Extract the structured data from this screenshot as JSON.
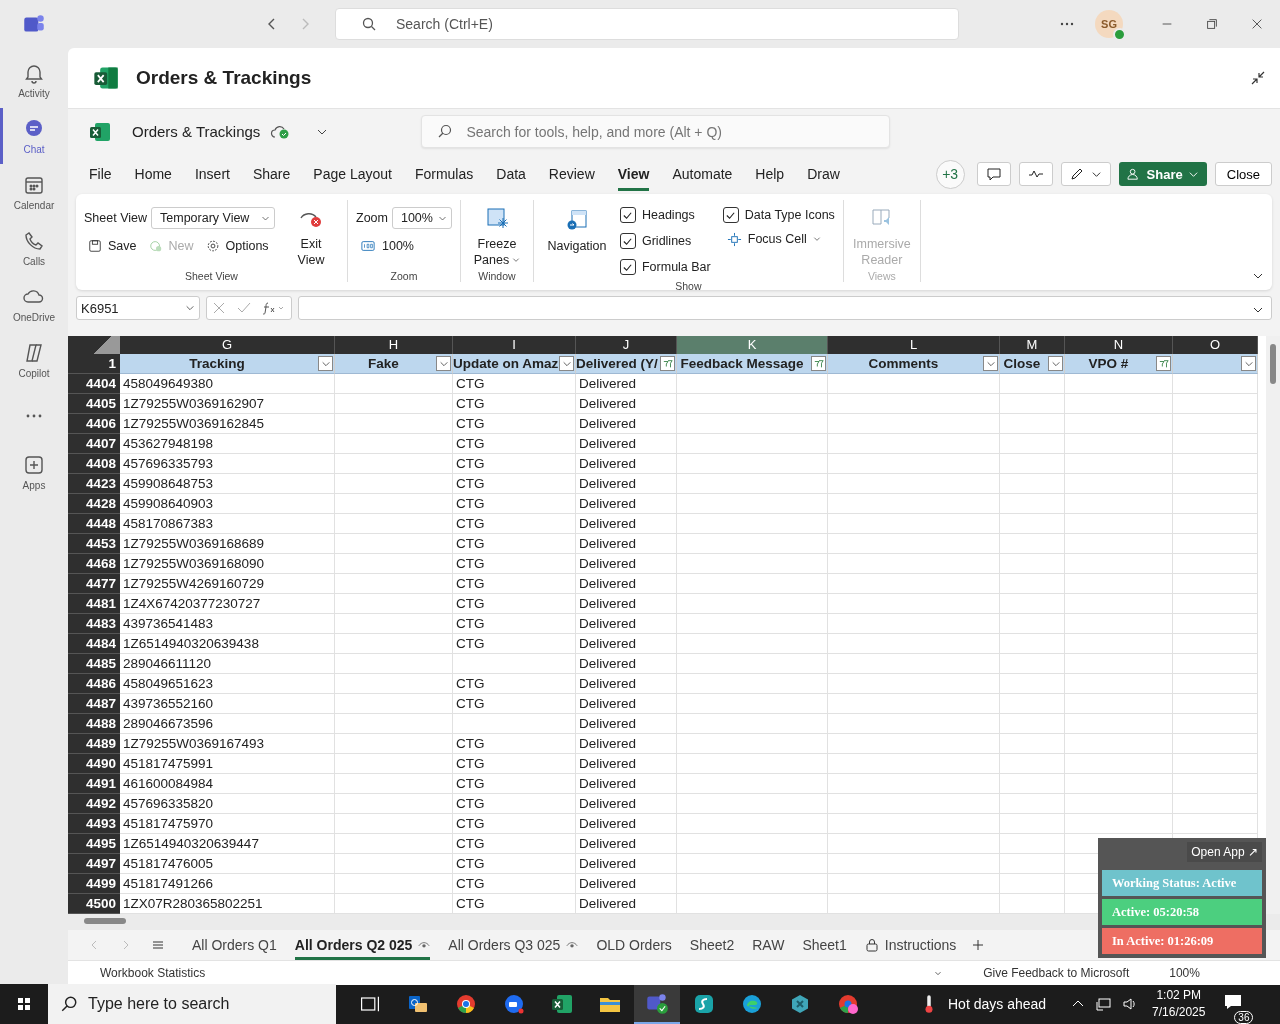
{
  "titlebar": {
    "search": {
      "placeholder": "Search (Ctrl+E)"
    },
    "avatar": "SG"
  },
  "rail": [
    {
      "label": "Activity",
      "kind": "bell",
      "selected": false
    },
    {
      "label": "Chat",
      "kind": "chat",
      "selected": true
    },
    {
      "label": "Calendar",
      "kind": "calendar",
      "selected": false
    },
    {
      "label": "Calls",
      "kind": "phone",
      "selected": false
    },
    {
      "label": "OneDrive",
      "kind": "cloud",
      "selected": false
    },
    {
      "label": "Copilot",
      "kind": "copilot",
      "selected": false
    },
    {
      "kind": "more",
      "selected": false
    },
    {
      "label": "Apps",
      "kind": "apps",
      "selected": false
    }
  ],
  "app_title": "Orders & Trackings",
  "document": {
    "name": "Orders & Trackings",
    "search": {
      "placeholder": "Search for tools, help, and more (Alt + Q)"
    }
  },
  "ribbon_tabs": [
    {
      "label": "File",
      "selected": false
    },
    {
      "label": "Home",
      "selected": false
    },
    {
      "label": "Insert",
      "selected": false
    },
    {
      "label": "Share",
      "selected": false
    },
    {
      "label": "Page Layout",
      "selected": false
    },
    {
      "label": "Formulas",
      "selected": false
    },
    {
      "label": "Data",
      "selected": false
    },
    {
      "label": "Review",
      "selected": false
    },
    {
      "label": "View",
      "selected": true
    },
    {
      "label": "Automate",
      "selected": false
    },
    {
      "label": "Help",
      "selected": false
    },
    {
      "label": "Draw",
      "selected": false
    }
  ],
  "ribbon_actions": {
    "collaborators": "+3",
    "share": "Share",
    "close": "Close"
  },
  "ribbon": {
    "sheet_view": {
      "label": "Sheet View",
      "value": "Temporary View",
      "save": "Save",
      "new": "New",
      "options": "Options",
      "exit": "Exit View",
      "group": "Sheet View"
    },
    "zoom": {
      "label": "Zoom",
      "value": "100%",
      "reset": "100%",
      "group": "Zoom"
    },
    "window": {
      "freeze": "Freeze Panes",
      "group": "Window"
    },
    "navigation": "Navigation",
    "show": {
      "checks": [
        {
          "label": "Headings",
          "checked": true
        },
        {
          "label": "Gridlines",
          "checked": true
        },
        {
          "label": "Formula Bar",
          "checked": true
        },
        {
          "label": "Data Type Icons",
          "checked": true
        }
      ],
      "focus_cell": "Focus Cell",
      "group": "Show"
    },
    "views": {
      "reader": "Immersive Reader",
      "group": "Views"
    }
  },
  "name_box": "K6951",
  "columns": [
    {
      "letter": "G",
      "header": "Tracking",
      "filtered": false,
      "selected": false
    },
    {
      "letter": "H",
      "header": "Fake",
      "filtered": false,
      "selected": false
    },
    {
      "letter": "I",
      "header": "Update on Amaz",
      "filtered": false,
      "selected": false
    },
    {
      "letter": "J",
      "header": "Delivered (Y/",
      "filtered": true,
      "selected": false
    },
    {
      "letter": "K",
      "header": "Feedback Message",
      "filtered": true,
      "selected": true
    },
    {
      "letter": "L",
      "header": "Comments",
      "filtered": false,
      "selected": false
    },
    {
      "letter": "M",
      "header": "Close",
      "filtered": false,
      "selected": false
    },
    {
      "letter": "N",
      "header": "VPO #",
      "filtered": true,
      "selected": false
    },
    {
      "letter": "O",
      "filtered": false,
      "selected": false
    }
  ],
  "header_row": "1",
  "rows": [
    [
      "4404",
      "458049649380",
      "CTG",
      "Delivered"
    ],
    [
      "4405",
      "1Z79255W0369162907",
      "CTG",
      "Delivered"
    ],
    [
      "4406",
      "1Z79255W0369162845",
      "CTG",
      "Delivered"
    ],
    [
      "4407",
      "453627948198",
      "CTG",
      "Delivered"
    ],
    [
      "4408",
      "457696335793",
      "CTG",
      "Delivered"
    ],
    [
      "4423",
      "459908648753",
      "CTG",
      "Delivered"
    ],
    [
      "4428",
      "459908640903",
      "CTG",
      "Delivered"
    ],
    [
      "4448",
      "458170867383",
      "CTG",
      "Delivered"
    ],
    [
      "4453",
      "1Z79255W0369168689",
      "CTG",
      "Delivered"
    ],
    [
      "4468",
      "1Z79255W0369168090",
      "CTG",
      "Delivered"
    ],
    [
      "4477",
      "1Z79255W4269160729",
      "CTG",
      "Delivered"
    ],
    [
      "4481",
      "1Z4X67420377230727",
      "CTG",
      "Delivered"
    ],
    [
      "4483",
      "439736541483",
      "CTG",
      "Delivered"
    ],
    [
      "4484",
      "1Z6514940320639438",
      "CTG",
      "Delivered"
    ],
    [
      "4485",
      "289046611120",
      "",
      "Delivered"
    ],
    [
      "4486",
      "458049651623",
      "CTG",
      "Delivered"
    ],
    [
      "4487",
      "439736552160",
      "CTG",
      "Delivered"
    ],
    [
      "4488",
      "289046673596",
      "",
      "Delivered"
    ],
    [
      "4489",
      "1Z79255W0369167493",
      "CTG",
      "Delivered"
    ],
    [
      "4490",
      "451817475991",
      "CTG",
      "Delivered"
    ],
    [
      "4491",
      "461600084984",
      "CTG",
      "Delivered"
    ],
    [
      "4492",
      "457696335820",
      "CTG",
      "Delivered"
    ],
    [
      "4493",
      "451817475970",
      "CTG",
      "Delivered"
    ],
    [
      "4495",
      "1Z6514940320639447",
      "CTG",
      "Delivered"
    ],
    [
      "4497",
      "451817476005",
      "CTG",
      "Delivered"
    ],
    [
      "4499",
      "451817491266",
      "CTG",
      "Delivered"
    ],
    [
      "4500",
      "1ZX07R280365802251",
      "CTG",
      "Delivered"
    ]
  ],
  "sheet_tabs": [
    {
      "label": "All Orders Q1",
      "kind": "plain",
      "selected": false
    },
    {
      "label": "All Orders Q2 025",
      "kind": "watched",
      "selected": true
    },
    {
      "label": "All Orders Q3 025",
      "kind": "watched",
      "selected": false
    },
    {
      "label": "OLD Orders",
      "kind": "plain",
      "selected": false
    },
    {
      "label": "Sheet2",
      "kind": "plain",
      "selected": false
    },
    {
      "label": "RAW",
      "kind": "plain",
      "selected": false
    },
    {
      "label": "Sheet1",
      "kind": "plain",
      "selected": false
    },
    {
      "label": "Instructions",
      "kind": "locked",
      "selected": false
    }
  ],
  "status_bar": {
    "left": "Workbook Statistics",
    "feedback": "Give Feedback to Microsoft",
    "zoom": "100%"
  },
  "tracker": {
    "open": "Open App ↗",
    "lines": [
      {
        "text": "Working Status: Active",
        "color": "#6fc3cc"
      },
      {
        "text": "Active: 05:20:58",
        "color": "#4ccf7f"
      },
      {
        "text": "In Active: 01:26:09",
        "color": "#ee6e63"
      }
    ]
  },
  "taskbar": {
    "search": {
      "placeholder": "Type here to search"
    },
    "weather": "Hot days ahead",
    "time": "1:02 PM",
    "date": "7/16/2025",
    "notifications": "36"
  }
}
